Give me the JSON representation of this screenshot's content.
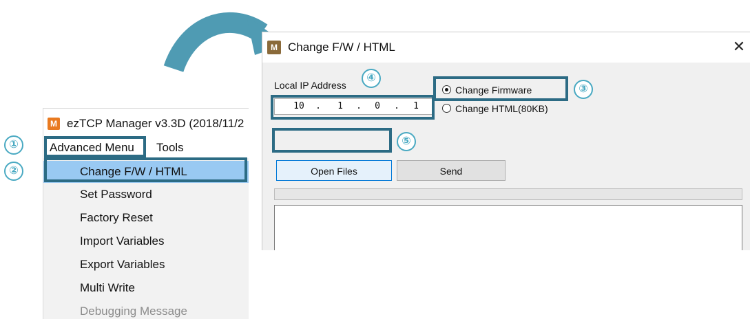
{
  "manager": {
    "app_icon": "M",
    "title": "ezTCP Manager v3.3D (2018/11/2",
    "menu": {
      "advanced": "Advanced Menu",
      "tools": "Tools"
    },
    "dropdown": [
      {
        "label": "Change F/W / HTML",
        "highlighted": true,
        "disabled": false
      },
      {
        "label": "Set Password",
        "highlighted": false,
        "disabled": false
      },
      {
        "label": "Factory Reset",
        "highlighted": false,
        "disabled": false
      },
      {
        "label": "Import Variables",
        "highlighted": false,
        "disabled": false
      },
      {
        "label": "Export Variables",
        "highlighted": false,
        "disabled": false
      },
      {
        "label": "Multi Write",
        "highlighted": false,
        "disabled": false
      },
      {
        "label": "Debugging Message",
        "highlighted": false,
        "disabled": true
      }
    ]
  },
  "dialog": {
    "app_icon": "M",
    "title": "Change F/W / HTML",
    "close_glyph": "✕",
    "ip_label": "Local IP Address",
    "ip": [
      "10",
      "1",
      "0",
      "1"
    ],
    "ip_sep": ".",
    "radio_firmware": "Change Firmware",
    "radio_html": "Change HTML(80KB)",
    "selected_radio": "firmware",
    "open_button": "Open Files",
    "send_button": "Send",
    "progress": 0
  },
  "steps": {
    "s1": "①",
    "s2": "②",
    "s3": "③",
    "s4": "④",
    "s5": "⑤"
  },
  "colors": {
    "highlight_box": "#2c6b84",
    "step_circle": "#49a9c2",
    "arrow": "#4f9bb3",
    "menu_highlight": "#99c9f2"
  }
}
